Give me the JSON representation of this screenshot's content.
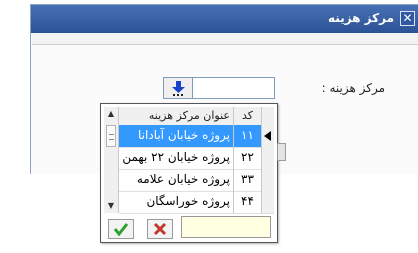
{
  "window": {
    "title": "مرکز هزینه",
    "close_glyph": "✕"
  },
  "form": {
    "field_label": "مرکز هزینه :",
    "code_value": ""
  },
  "lookup": {
    "columns": {
      "title": "عنوان مرکز هزینه",
      "code": "کد"
    },
    "rows": [
      {
        "code": "۱۱",
        "title": "پروژه خیابان آبادانا",
        "selected": true
      },
      {
        "code": "۲۲",
        "title": "پروژه خیابان ۲۲ بهمن",
        "selected": false
      },
      {
        "code": "۳۳",
        "title": "پروژه خیابان علامه",
        "selected": false
      },
      {
        "code": "۴۴",
        "title": "پروژه خوراسگان",
        "selected": false
      }
    ],
    "filter_value": "",
    "colors": {
      "selection": "#3399ff",
      "ok": "#2e9e2e",
      "cancel": "#c0392b",
      "filter_bg": "#ffffe1"
    }
  }
}
